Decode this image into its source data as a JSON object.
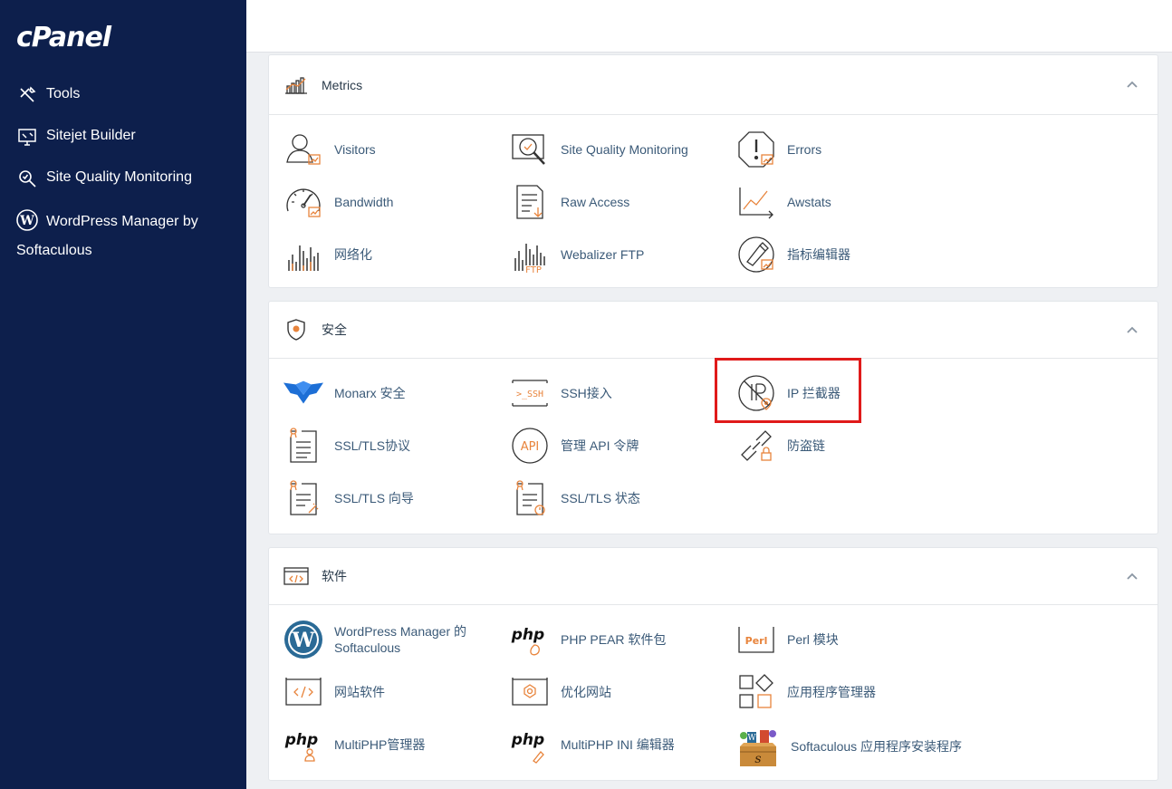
{
  "brand": {
    "logo": "cPanel"
  },
  "sidebar": {
    "items": [
      {
        "label": "Tools",
        "icon": "tools-icon"
      },
      {
        "label": "Sitejet Builder",
        "icon": "sitejet-icon"
      },
      {
        "label": "Site Quality Monitoring",
        "icon": "site-quality-icon"
      },
      {
        "label": "WordPress Manager by Softaculous",
        "icon": "wordpress-icon"
      }
    ]
  },
  "sections": {
    "metrics": {
      "title": "Metrics",
      "items": [
        {
          "label": "Visitors",
          "icon": "visitors-icon"
        },
        {
          "label": "Site Quality Monitoring",
          "icon": "site-quality-monitoring-icon"
        },
        {
          "label": "Errors",
          "icon": "errors-icon"
        },
        {
          "label": "Bandwidth",
          "icon": "bandwidth-icon"
        },
        {
          "label": "Raw Access",
          "icon": "raw-access-icon"
        },
        {
          "label": "Awstats",
          "icon": "awstats-icon"
        },
        {
          "label": "网络化",
          "icon": "webalizer-icon"
        },
        {
          "label": "Webalizer FTP",
          "icon": "webalizer-ftp-icon"
        },
        {
          "label": "指标编辑器",
          "icon": "metrics-editor-icon"
        }
      ]
    },
    "security": {
      "title": "安全",
      "items": [
        {
          "label": "Monarx 安全",
          "icon": "monarx-icon"
        },
        {
          "label": "SSH接入",
          "icon": "ssh-icon"
        },
        {
          "label": "IP 拦截器",
          "icon": "ip-blocker-icon"
        },
        {
          "label": "SSL/TLS协议",
          "icon": "ssl-tls-icon"
        },
        {
          "label": "管理 API 令牌",
          "icon": "api-token-icon"
        },
        {
          "label": "防盗链",
          "icon": "hotlink-icon"
        },
        {
          "label": "SSL/TLS 向导",
          "icon": "ssl-wizard-icon"
        },
        {
          "label": "SSL/TLS 状态",
          "icon": "ssl-status-icon"
        }
      ]
    },
    "software": {
      "title": "软件",
      "items": [
        {
          "label": "WordPress Manager 的 Softaculous",
          "line1": "WordPress Manager 的",
          "line2": "Softaculous",
          "icon": "wordpress-manager-icon"
        },
        {
          "label": "PHP PEAR 软件包",
          "icon": "php-pear-icon"
        },
        {
          "label": "Perl 模块",
          "icon": "perl-icon"
        },
        {
          "label": "网站软件",
          "icon": "site-software-icon"
        },
        {
          "label": "优化网站",
          "icon": "optimize-icon"
        },
        {
          "label": "应用程序管理器",
          "icon": "app-manager-icon"
        },
        {
          "label": "MultiPHP管理器",
          "icon": "multiphp-manager-icon"
        },
        {
          "label": "MultiPHP INI 编辑器",
          "icon": "multiphp-ini-icon"
        },
        {
          "label": "Softaculous 应用程序安装程序",
          "icon": "softaculous-icon"
        }
      ]
    }
  },
  "icon_text": {
    "ssh": ">_SSH",
    "api": "API",
    "ftp": "FTP",
    "php": "php",
    "perl": "Perl"
  },
  "colors": {
    "sidebar": "#0d1f4c",
    "accent": "#e8843c",
    "link": "#3b5a78",
    "highlight": "#e01a1a",
    "monarx": "#1d6fd6"
  }
}
